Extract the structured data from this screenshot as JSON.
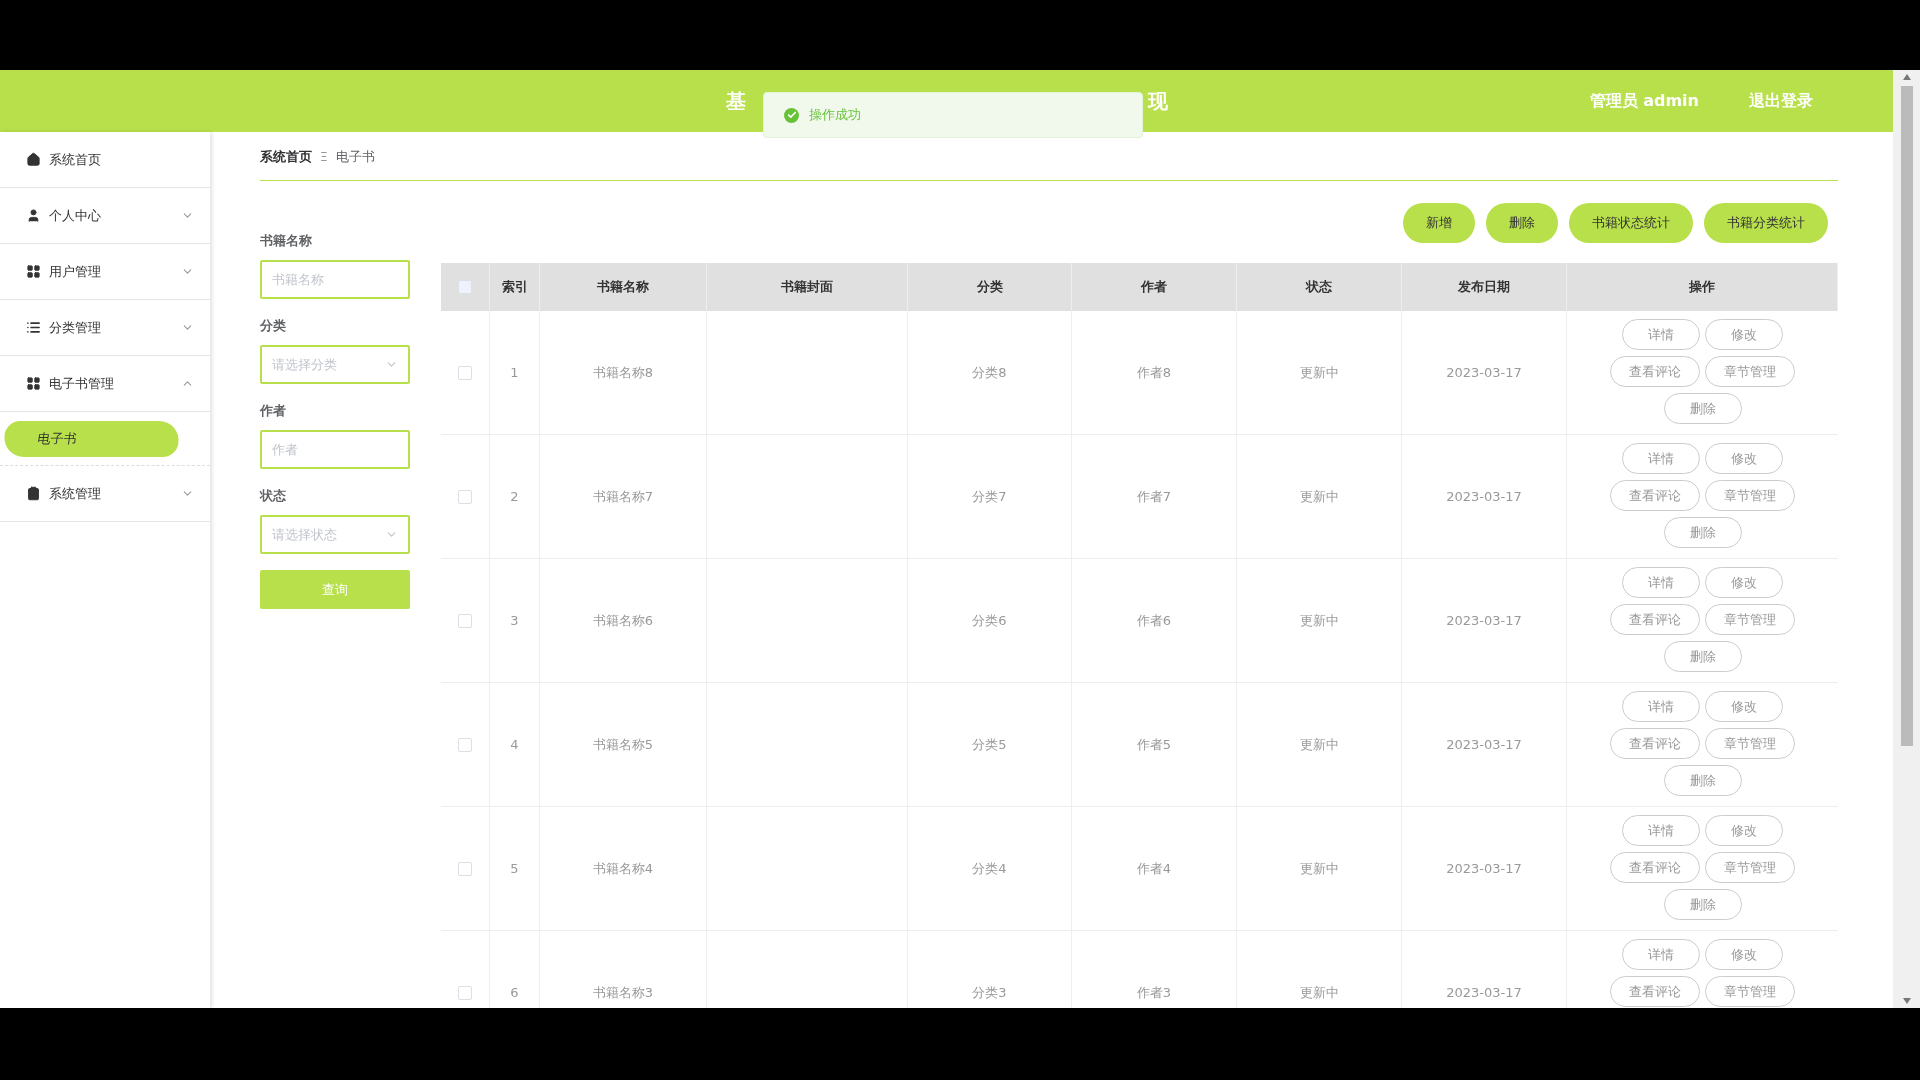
{
  "header": {
    "title_left": "基",
    "title_right": "现",
    "user": "管理员 admin",
    "logout": "退出登录"
  },
  "toast": {
    "message": "操作成功"
  },
  "sidebar": {
    "items": [
      {
        "label": "系统首页"
      },
      {
        "label": "个人中心",
        "expanded": false
      },
      {
        "label": "用户管理",
        "expanded": false
      },
      {
        "label": "分类管理",
        "expanded": false
      },
      {
        "label": "电子书管理",
        "expanded": true,
        "children": [
          {
            "label": "电子书",
            "selected": true
          }
        ]
      },
      {
        "label": "系统管理",
        "expanded": false
      }
    ]
  },
  "breadcrumb": {
    "items": [
      "系统首页",
      "电子书"
    ],
    "separator": "Ξ"
  },
  "filters": {
    "fields": [
      {
        "label": "书籍名称",
        "kind": "input",
        "placeholder": "书籍名称"
      },
      {
        "label": "分类",
        "kind": "select",
        "placeholder": "请选择分类"
      },
      {
        "label": "作者",
        "kind": "input",
        "placeholder": "作者"
      },
      {
        "label": "状态",
        "kind": "select",
        "placeholder": "请选择状态"
      }
    ],
    "search_button": "查询"
  },
  "toolbar": {
    "buttons": [
      "新增",
      "删除",
      "书籍状态统计",
      "书籍分类统计"
    ]
  },
  "table": {
    "select_all_checked": false,
    "columns": [
      "索引",
      "书籍名称",
      "书籍封面",
      "分类",
      "作者",
      "状态",
      "发布日期",
      "操作"
    ],
    "rows": [
      {
        "checked": false,
        "index": "1",
        "name": "书籍名称8",
        "category": "分类8",
        "author": "作者8",
        "status": "更新中",
        "date": "2023-03-17",
        "actions": [
          "详情",
          "修改",
          "查看评论",
          "章节管理",
          "删除"
        ]
      },
      {
        "checked": false,
        "index": "2",
        "name": "书籍名称7",
        "category": "分类7",
        "author": "作者7",
        "status": "更新中",
        "date": "2023-03-17",
        "actions": [
          "详情",
          "修改",
          "查看评论",
          "章节管理",
          "删除"
        ]
      },
      {
        "checked": false,
        "index": "3",
        "name": "书籍名称6",
        "category": "分类6",
        "author": "作者6",
        "status": "更新中",
        "date": "2023-03-17",
        "actions": [
          "详情",
          "修改",
          "查看评论",
          "章节管理",
          "删除"
        ]
      },
      {
        "checked": false,
        "index": "4",
        "name": "书籍名称5",
        "category": "分类5",
        "author": "作者5",
        "status": "更新中",
        "date": "2023-03-17",
        "actions": [
          "详情",
          "修改",
          "查看评论",
          "章节管理",
          "删除"
        ]
      },
      {
        "checked": false,
        "index": "5",
        "name": "书籍名称4",
        "category": "分类4",
        "author": "作者4",
        "status": "更新中",
        "date": "2023-03-17",
        "actions": [
          "详情",
          "修改",
          "查看评论",
          "章节管理",
          "删除"
        ]
      },
      {
        "checked": false,
        "index": "6",
        "name": "书籍名称3",
        "category": "分类3",
        "author": "作者3",
        "status": "更新中",
        "date": "2023-03-17",
        "actions": [
          "详情",
          "修改",
          "查看评论",
          "章节管理"
        ]
      }
    ]
  }
}
